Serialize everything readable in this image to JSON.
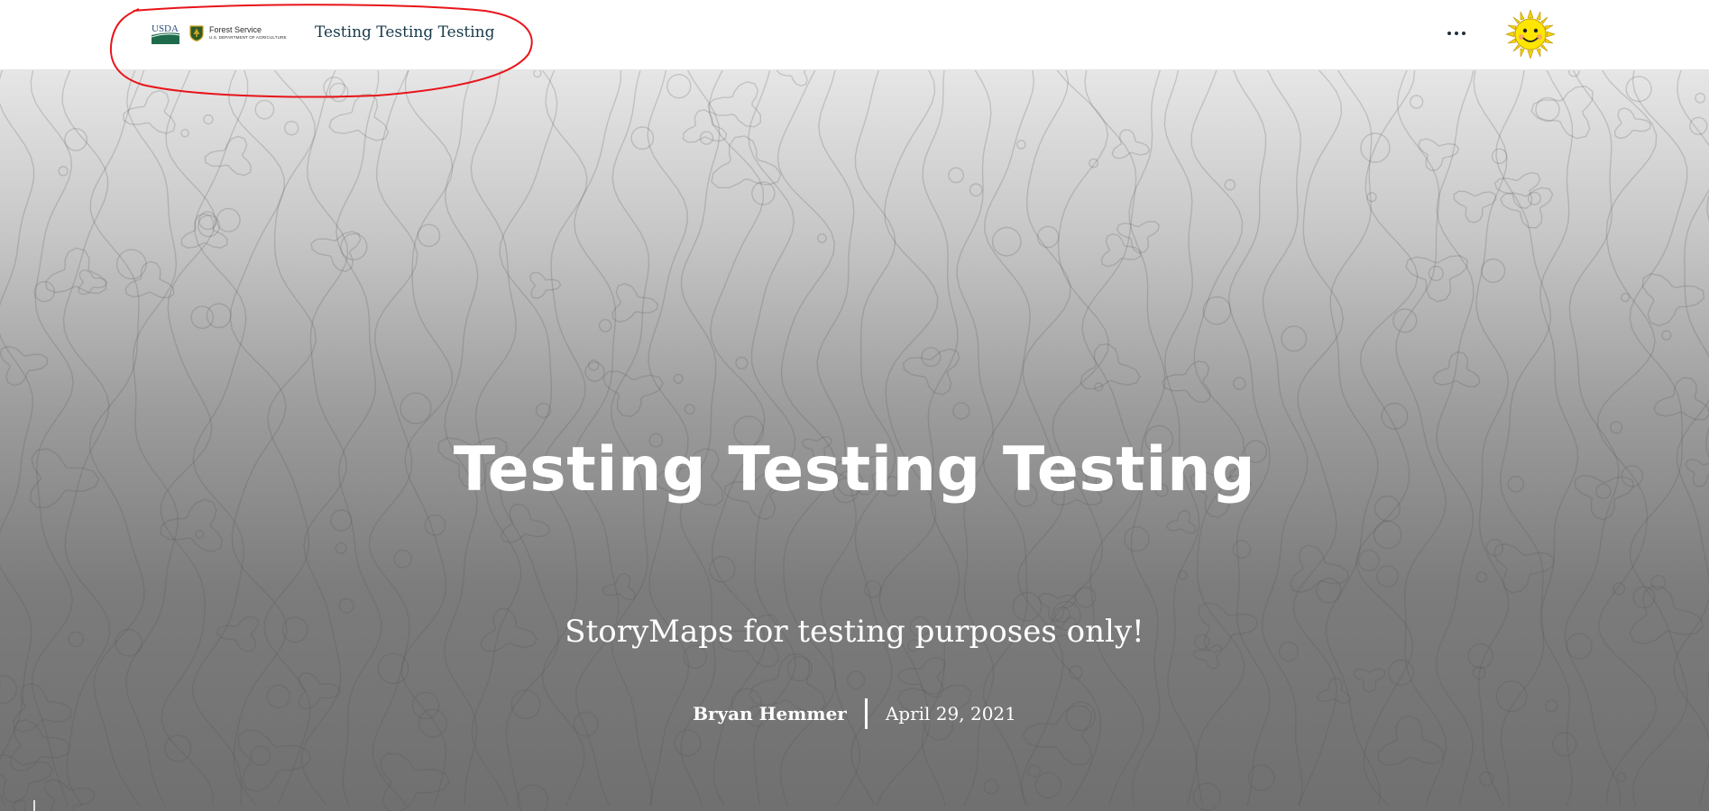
{
  "header": {
    "logos": {
      "usda_text": "USDA",
      "forest_service_name": "Forest Service",
      "forest_service_dept": "U.S. DEPARTMENT OF AGRICULTURE"
    },
    "title": "Testing Testing Testing",
    "more_icon": "more-horizontal-icon",
    "avatar_icon": "sun-smiley-avatar"
  },
  "hero": {
    "title": "Testing Testing Testing",
    "subtitle": "StoryMaps for testing purposes only!",
    "author": "Bryan Hemmer",
    "date": "April 29, 2021",
    "scroll_icon": "arrow-down-icon"
  },
  "colors": {
    "header_title": "#173a4b",
    "usda_blue": "#2d4f7c",
    "usda_green": "#1e6b4c",
    "annotation_red": "#e8141a",
    "hero_text": "#ffffff"
  }
}
